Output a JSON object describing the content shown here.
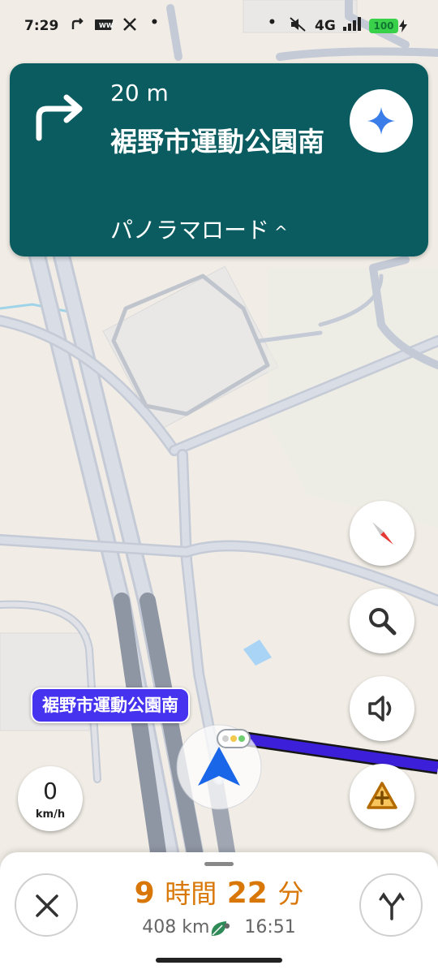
{
  "status_bar": {
    "time": "7:29",
    "network": "4G",
    "battery": "100",
    "icons": [
      "navigation-arrow-icon",
      "news-icon",
      "x-logo-icon",
      "dot-icon",
      "mute-icon",
      "signal-icon"
    ]
  },
  "navigation": {
    "distance": "20 m",
    "street": "裾野市運動公園南",
    "via": "パノラマロード",
    "via_chevron": "^",
    "turn": "right-turn-icon"
  },
  "map": {
    "destination_label": "裾野市運動公園南",
    "route_color": "#3c1fd8"
  },
  "speed": {
    "value": "0",
    "unit": "km/h"
  },
  "controls": [
    "compass-icon",
    "search-icon",
    "volume-icon",
    "report-hazard-icon"
  ],
  "trip": {
    "duration_hours": "9",
    "hours_unit": "時間",
    "duration_minutes": "22",
    "minutes_unit": "分",
    "distance": "408 km",
    "separator": "•",
    "arrival_time": "16:51"
  },
  "colors": {
    "nav_card": "#0b5c60",
    "eta": "#d97706",
    "route": "#3c1fd8",
    "eco_leaf": "#2e8b57"
  }
}
